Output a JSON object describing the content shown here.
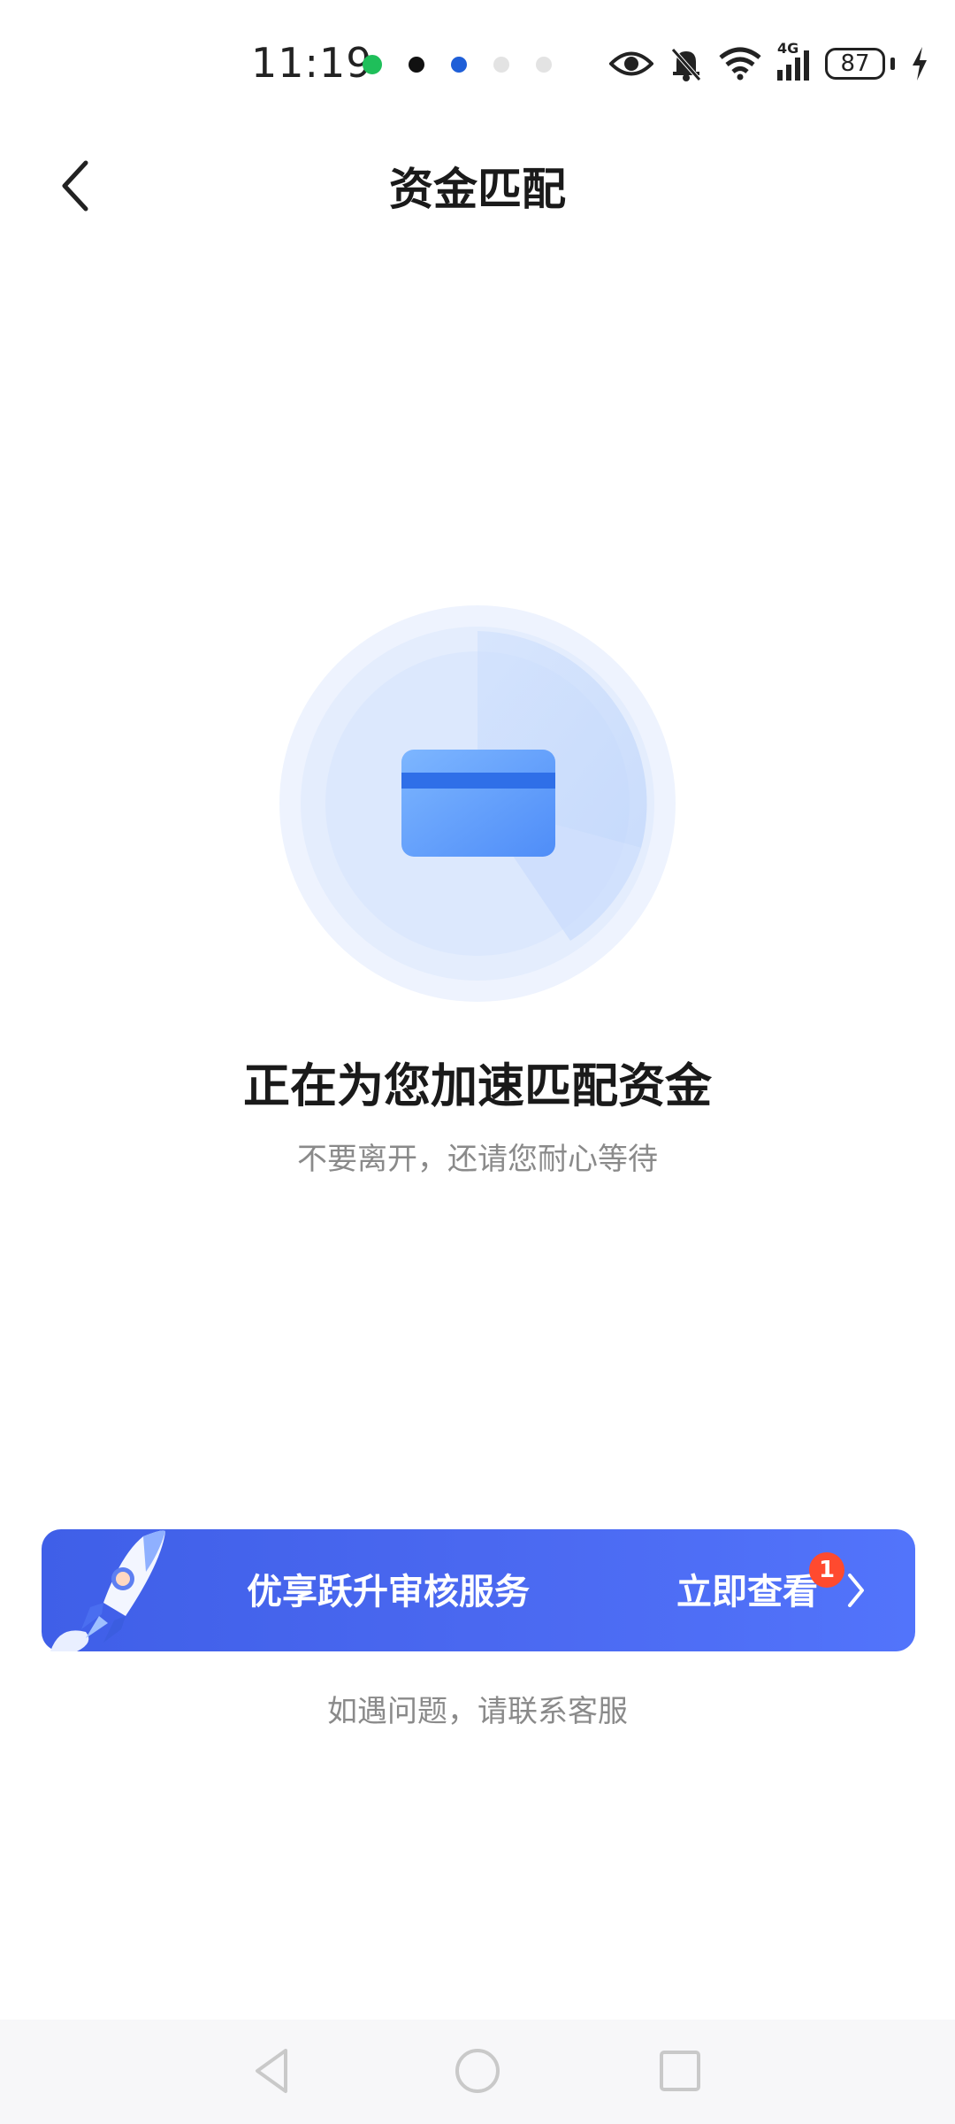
{
  "status_bar": {
    "time": "11:19",
    "battery_level": "87",
    "network": "4G",
    "icons": [
      "wechat-icon",
      "tiktok-icon",
      "app-icon",
      "cat-icon",
      "cat-icon",
      "eye-icon",
      "bell-off-icon",
      "wifi-icon",
      "signal-icon",
      "battery-icon",
      "charging-icon"
    ]
  },
  "header": {
    "title": "资金匹配",
    "back_icon": "chevron-left-icon"
  },
  "main": {
    "graphic_icon": "credit-card-icon",
    "heading": "正在为您加速匹配资金",
    "subheading": "不要离开，还请您耐心等待"
  },
  "promo": {
    "text": "优享跃升审核服务",
    "cta": "立即查看",
    "badge": "1",
    "icon": "rocket-icon"
  },
  "support": {
    "text": "如遇问题，请联系客服"
  },
  "nav_bar": {
    "buttons": [
      "back-triangle-icon",
      "home-circle-icon",
      "recents-square-icon"
    ]
  },
  "colors": {
    "accent": "#4a68f0",
    "badge": "#ff4a2f",
    "radar_light": "#e8f0fe",
    "card_blue": "#5a9bff"
  }
}
